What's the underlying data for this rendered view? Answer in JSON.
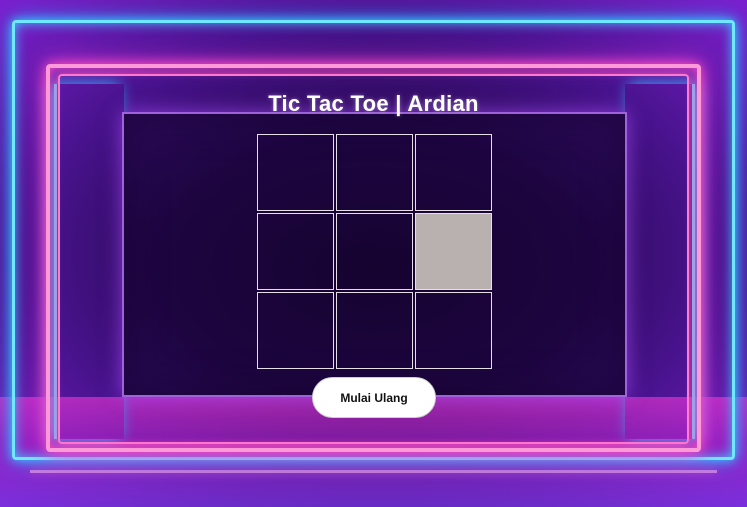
{
  "game": {
    "title": "Tic Tac Toe | Ardian",
    "board": {
      "cells": [
        "",
        "",
        "",
        "",
        "",
        "",
        "",
        "",
        ""
      ],
      "hovered_cell": 5
    },
    "restart_label": "Mulai Ulang"
  },
  "colors": {
    "cell_border": "#e6e0e6",
    "hovered_cell_bg": "#b9b0b0",
    "button_bg": "#ffffff",
    "title_text": "#ffffff",
    "neon_pink": "#ff4fc2",
    "neon_cyan": "#3cc8ff"
  }
}
